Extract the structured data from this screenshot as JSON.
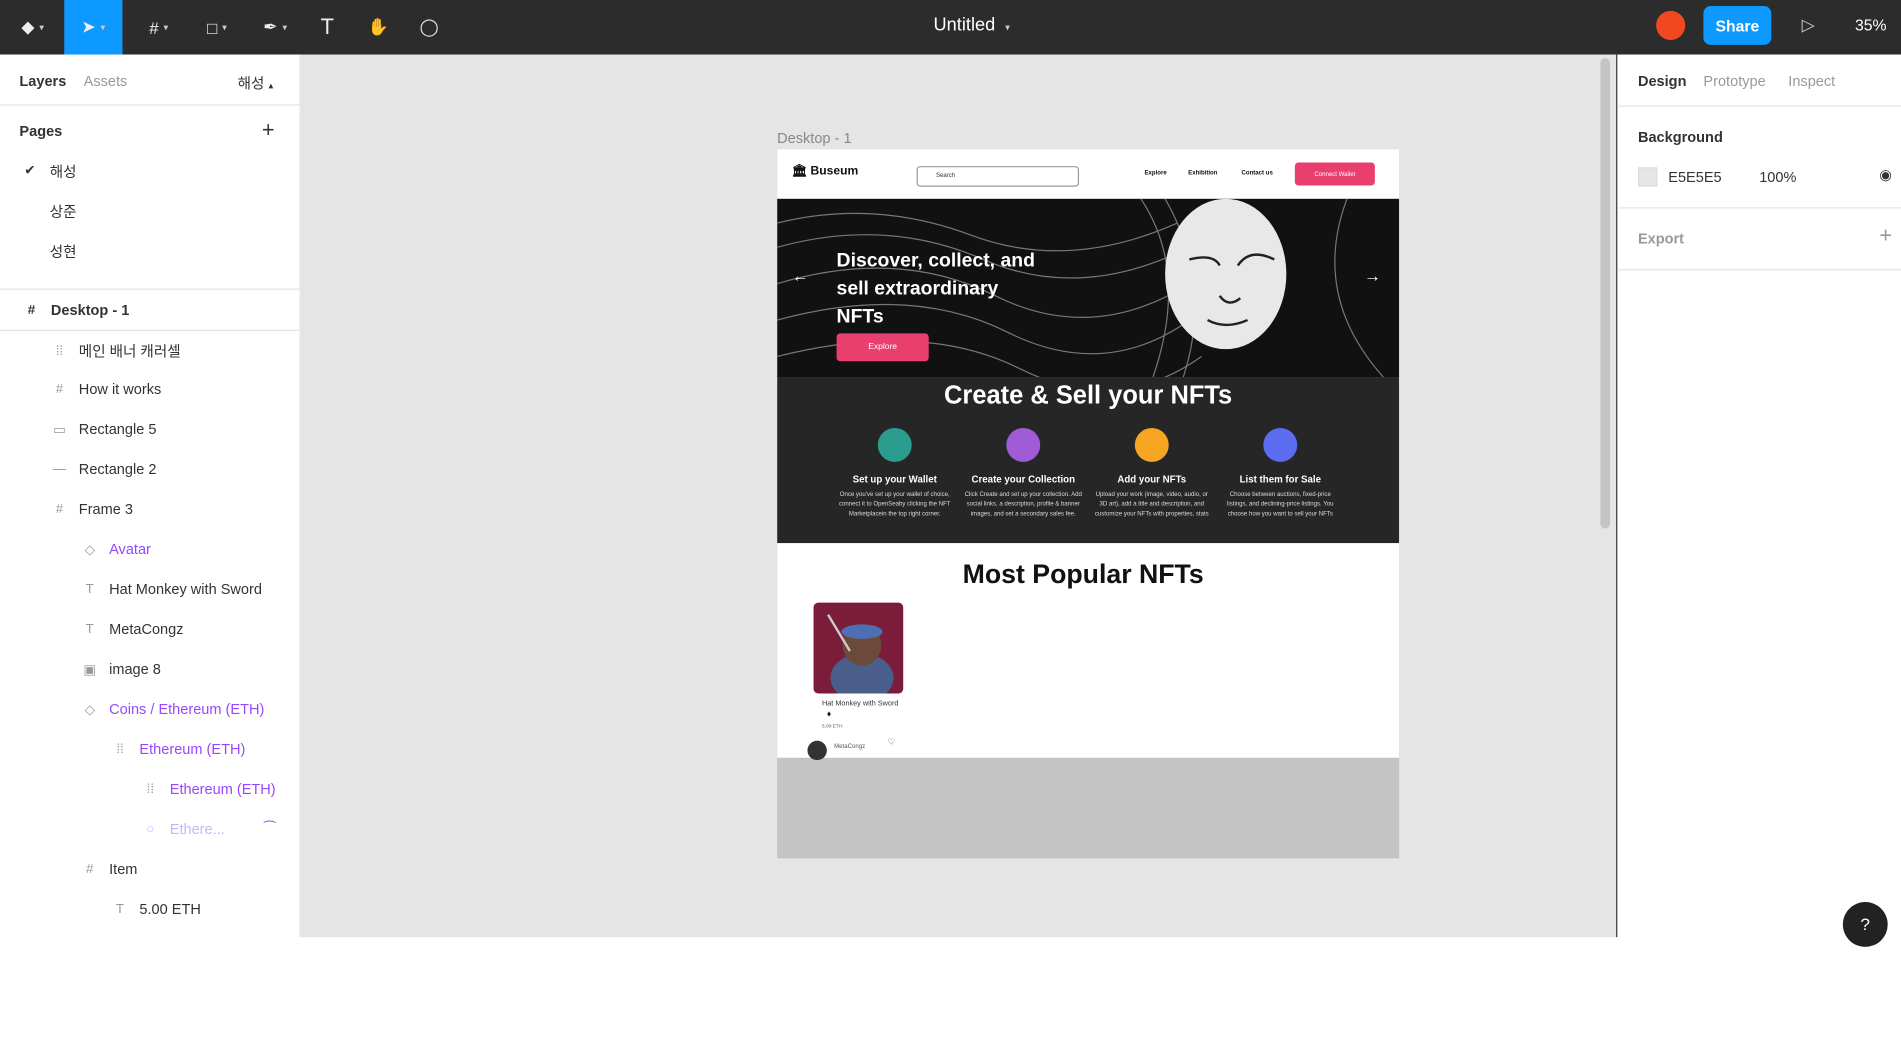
{
  "toolbar": {
    "doc_title": "Untitled",
    "share_label": "Share",
    "zoom": "35%"
  },
  "left_panel": {
    "tabs": [
      "Layers",
      "Assets"
    ],
    "page_selector": "해성",
    "pages_heading": "Pages",
    "pages": [
      "해성",
      "상준",
      "성현"
    ],
    "frame": "Desktop - 1",
    "layers": [
      {
        "label": "메인 배너 캐러셀",
        "icon": "component-instance-icon"
      },
      {
        "label": "How it works",
        "icon": "frame-icon"
      },
      {
        "label": "Rectangle 5",
        "icon": "rectangle-icon"
      },
      {
        "label": "Rectangle 2",
        "icon": "line-icon"
      },
      {
        "label": "Frame 3",
        "icon": "frame-icon"
      },
      {
        "label": "Avatar",
        "icon": "component-icon"
      },
      {
        "label": "Hat Monkey with Sword",
        "icon": "text-icon"
      },
      {
        "label": "MetaCongz",
        "icon": "text-icon"
      },
      {
        "label": "image 8",
        "icon": "image-icon"
      },
      {
        "label": "Coins / Ethereum (ETH)",
        "icon": "component-icon"
      },
      {
        "label": "Ethereum (ETH)",
        "icon": "component-instance-icon"
      },
      {
        "label": "Ethereum (ETH)",
        "icon": "component-instance-icon"
      },
      {
        "label": "Ethere...",
        "icon": "ellipse-icon"
      },
      {
        "label": "Item",
        "icon": "frame-icon"
      },
      {
        "label": "5.00 ETH",
        "icon": "text-icon"
      }
    ]
  },
  "canvas": {
    "frame_label": "Desktop - 1",
    "site": {
      "logo": "Buseum",
      "search_placeholder": "Search",
      "nav": [
        "Explore",
        "Exhibition",
        "Contact us"
      ],
      "connect_wallet": "Connect Wallet",
      "hero_title": "Discover, collect, and sell extraordinary NFTs",
      "hero_button": "Explore",
      "how_title": "Create & Sell your NFTs",
      "steps": [
        {
          "title": "Set up your Wallet",
          "desc": "Once you've set up your wallet of choice, connect it to OpenSeaby clicking the NFT Marketplacein the top right corner.",
          "color": "#2a9d8f"
        },
        {
          "title": "Create your Collection",
          "desc": "Click Create and set up your collection. Add social links, a description, profile & banner images, and set a secondary sales fee.",
          "color": "#a05cd6"
        },
        {
          "title": "Add your NFTs",
          "desc": "Upload your work (image, video, audio, or 3D art), add a title and description, and customize your NFTs with properties, stats",
          "color": "#f6a623"
        },
        {
          "title": "List them for Sale",
          "desc": "Choose between auctions, fixed-price listings, and declining-price listings. You choose how you want to sell your NFTs",
          "color": "#5b6cf0"
        }
      ],
      "popular_title": "Most Popular NFTs",
      "card": {
        "title": "Hat Monkey with Sword",
        "price": "5.00 ETH",
        "owner": "MetaCongz"
      }
    }
  },
  "right_panel": {
    "tabs": [
      "Design",
      "Prototype",
      "Inspect"
    ],
    "background_heading": "Background",
    "bg_hex": "E5E5E5",
    "bg_opacity": "100%",
    "export_heading": "Export"
  },
  "help": "?"
}
